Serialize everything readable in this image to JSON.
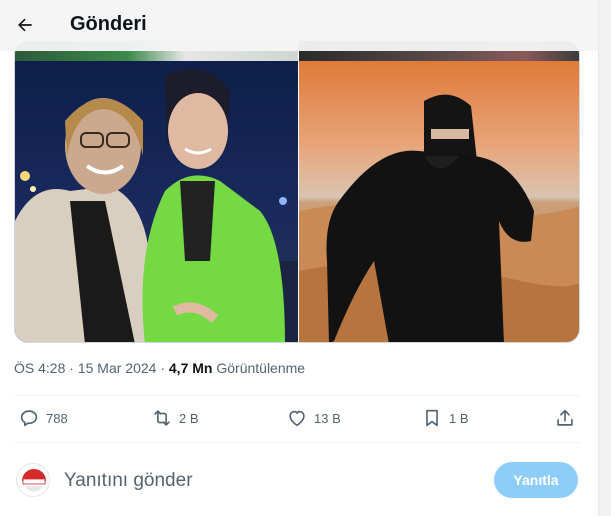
{
  "header": {
    "title": "Gönderi",
    "back_icon": "arrow-left-icon"
  },
  "media": {
    "left_image": "photo of two smiling women, one in green blazer with headscarf",
    "right_image": "photo of woman in black veil in desert at sunset"
  },
  "meta": {
    "time": "ÖS 4:28",
    "dot1": "·",
    "date": "15 Mar 2024",
    "dot2": "·",
    "views_count": "4,7 Mn",
    "views_label": "Görüntülenme"
  },
  "actions": {
    "replies": {
      "icon": "reply-icon",
      "count": "788"
    },
    "reposts": {
      "icon": "repost-icon",
      "count": "2 B"
    },
    "likes": {
      "icon": "heart-icon",
      "count": "13 B"
    },
    "bookmarks": {
      "icon": "bookmark-icon",
      "count": "1 B"
    },
    "share": {
      "icon": "share-icon"
    }
  },
  "reply": {
    "placeholder": "Yanıtını gönder",
    "button_label": "Yanıtla",
    "button_color": "#8ecdf8"
  },
  "colors": {
    "text_primary": "#0f1419",
    "text_secondary": "#536471",
    "accent": "#1d9bf0"
  }
}
